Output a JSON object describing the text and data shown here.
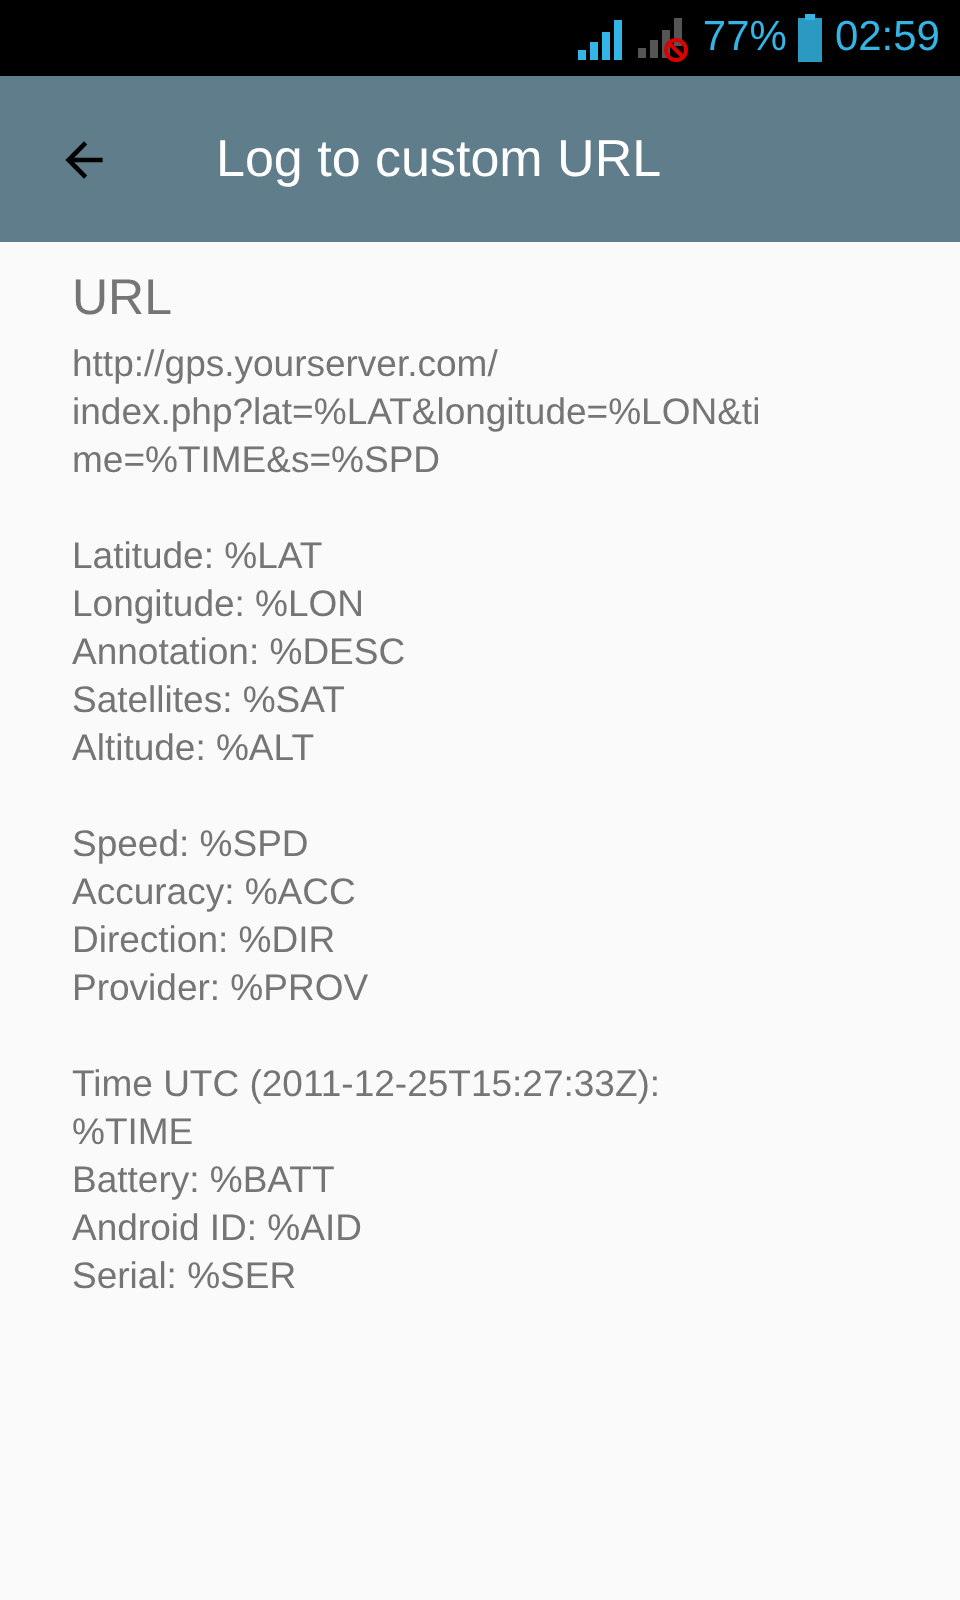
{
  "status_bar": {
    "battery_percent": "77%",
    "time": "02:59"
  },
  "toolbar": {
    "title": "Log to custom URL"
  },
  "preference": {
    "title": "URL",
    "summary_groups": [
      [
        "http://gps.yourserver.com/",
        "index.php?lat=%LAT&longitude=%LON&ti",
        "me=%TIME&s=%SPD"
      ],
      [
        "Latitude: %LAT",
        "Longitude: %LON",
        "Annotation: %DESC",
        "Satellites: %SAT",
        "Altitude: %ALT"
      ],
      [
        "Speed: %SPD",
        "Accuracy: %ACC",
        "Direction: %DIR",
        "Provider: %PROV"
      ],
      [
        "Time UTC (2011-12-25T15:27:33Z):",
        "%TIME",
        "Battery: %BATT",
        "Android ID: %AID",
        "Serial: %SER"
      ]
    ]
  }
}
